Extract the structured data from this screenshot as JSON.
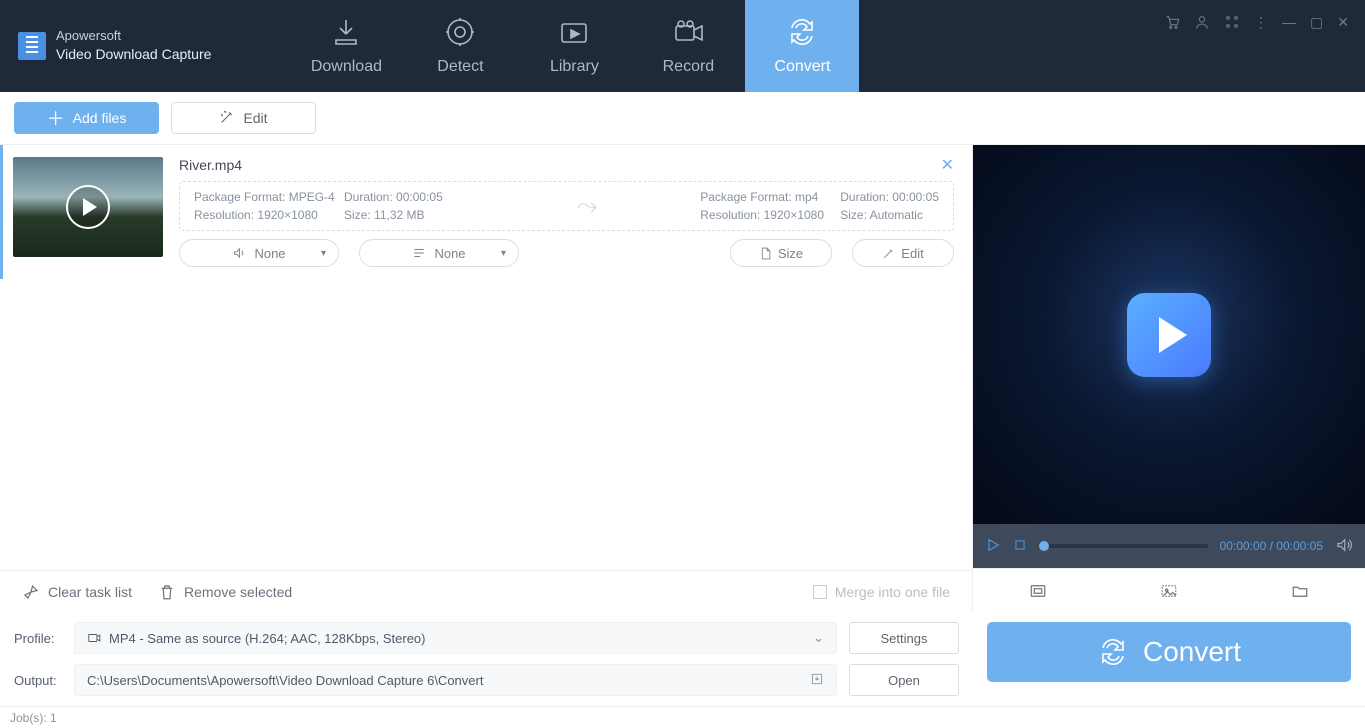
{
  "app": {
    "brand": "Apowersoft",
    "title": "Video Download Capture"
  },
  "tabs": {
    "download": "Download",
    "detect": "Detect",
    "library": "Library",
    "record": "Record",
    "convert": "Convert"
  },
  "toolbar": {
    "add_files": "Add files",
    "edit": "Edit"
  },
  "file": {
    "name": "River.mp4",
    "src": {
      "pkg_label": "Package Format:",
      "pkg_val": "MPEG-4",
      "dur_label": "Duration:",
      "dur_val": "00:00:05",
      "res_label": "Resolution:",
      "res_val": "1920×1080",
      "size_label": "Size:",
      "size_val": "11,32 MB"
    },
    "dst": {
      "pkg_label": "Package Format:",
      "pkg_val": "mp4",
      "dur_label": "Duration:",
      "dur_val": "00:00:05",
      "res_label": "Resolution:",
      "res_val": "1920×1080",
      "size_label": "Size:",
      "size_val": "Automatic"
    },
    "dd1": "None",
    "dd2": "None",
    "btn_size": "Size",
    "btn_edit": "Edit"
  },
  "taskbar": {
    "clear": "Clear task list",
    "remove": "Remove selected",
    "merge": "Merge into one file"
  },
  "profile": {
    "label": "Profile:",
    "value": "MP4 - Same as source (H.264; AAC, 128Kbps, Stereo)",
    "settings": "Settings"
  },
  "output": {
    "label": "Output:",
    "value": "C:\\Users\\Documents\\Apowersoft\\Video Download Capture 6\\Convert",
    "open": "Open"
  },
  "player": {
    "time": "00:00:00 / 00:00:05"
  },
  "convert_btn": "Convert",
  "status": {
    "label": "Job(s):",
    "count": "1"
  }
}
